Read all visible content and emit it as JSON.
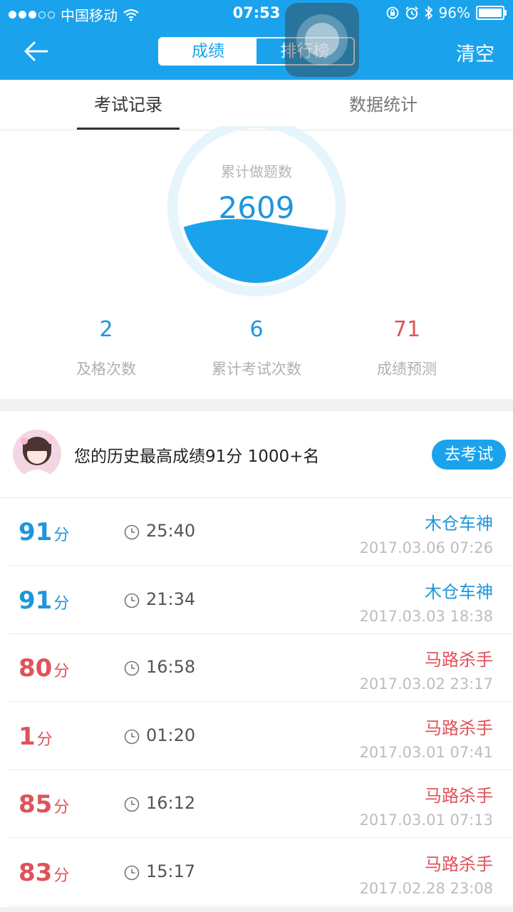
{
  "status_bar": {
    "carrier": "中国移动",
    "time": "07:53",
    "battery": "96%"
  },
  "nav": {
    "segments": [
      "成绩",
      "排行榜"
    ],
    "clear_label": "清空"
  },
  "tabs": [
    "考试记录",
    "数据统计"
  ],
  "gauge": {
    "label": "累计做题数",
    "value": "2609"
  },
  "stats": [
    {
      "value": "2",
      "label": "及格次数"
    },
    {
      "value": "6",
      "label": "累计考试次数"
    },
    {
      "value": "71",
      "label": "成绩预测"
    }
  ],
  "best": {
    "text": "您的历史最高成绩91分  1000+名",
    "button": "去考试"
  },
  "records": [
    {
      "score": "91",
      "unit": "分",
      "duration": "25:40",
      "title": "木仓车神",
      "date": "2017.03.06 07:26",
      "color": "#1e96dc"
    },
    {
      "score": "91",
      "unit": "分",
      "duration": "21:34",
      "title": "木仓车神",
      "date": "2017.03.03 18:38",
      "color": "#1e96dc"
    },
    {
      "score": "80",
      "unit": "分",
      "duration": "16:58",
      "title": "马路杀手",
      "date": "2017.03.02 23:17",
      "color": "#e0525a"
    },
    {
      "score": "1",
      "unit": "分",
      "duration": "01:20",
      "title": "马路杀手",
      "date": "2017.03.01 07:41",
      "color": "#e0525a"
    },
    {
      "score": "85",
      "unit": "分",
      "duration": "16:12",
      "title": "马路杀手",
      "date": "2017.03.01 07:13",
      "color": "#e0525a"
    },
    {
      "score": "83",
      "unit": "分",
      "duration": "15:17",
      "title": "马路杀手",
      "date": "2017.02.28 23:08",
      "color": "#e0525a"
    }
  ],
  "colors": {
    "brand": "#1aa3ec",
    "pass": "#1e96dc",
    "fail": "#e0525a"
  }
}
